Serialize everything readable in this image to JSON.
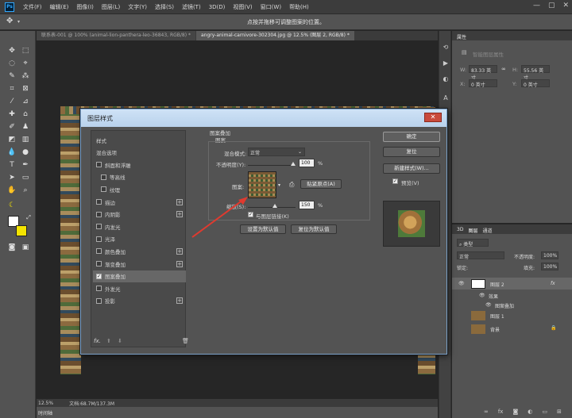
{
  "menubar": {
    "app_icon": "Ps",
    "items": [
      "文件(F)",
      "编辑(E)",
      "图像(I)",
      "图层(L)",
      "文字(Y)",
      "选择(S)",
      "滤镜(T)",
      "3D(D)",
      "视图(V)",
      "窗口(W)",
      "帮助(H)"
    ]
  },
  "optionsbar": {
    "hint": "点按并拖移可调整图案的位置。"
  },
  "tabs": [
    {
      "label": "联系表-001 @ 100% (animal-lion-panthera-leo-36843, RGB/8) *",
      "active": false
    },
    {
      "label": "angry-animal-carnivore-302304.jpg @ 12.5% (图层 2, RGB/8) *",
      "active": true
    }
  ],
  "status": {
    "zoom": "12.5%",
    "doc": "文档:68.7M/137.3M",
    "timeline": "时间轴"
  },
  "properties": {
    "tab": "属性",
    "title": "智能图层属性",
    "w_label": "W:",
    "w_value": "83.33 英寸",
    "h_label": "H:",
    "h_value": "55.56 英寸",
    "x_label": "X:",
    "x_value": "0 英寸",
    "y_label": "Y:",
    "y_value": "0 英寸"
  },
  "layers": {
    "tabs": [
      "3D",
      "图层",
      "通道"
    ],
    "filter": "类型",
    "blend": "正常",
    "opacity_label": "不透明度:",
    "opacity": "100%",
    "lock_label": "锁定:",
    "fill_label": "填充:",
    "fill": "100%",
    "rows": [
      {
        "name": "图层 2",
        "fx": "fx"
      },
      {
        "name": "效果"
      },
      {
        "name": "图案叠加"
      },
      {
        "name": "图层 1"
      },
      {
        "name": "背景"
      }
    ]
  },
  "dialog": {
    "title": "图层样式",
    "close": "✕",
    "styles": [
      {
        "label": "样式",
        "cb": false,
        "plus": false,
        "header": true
      },
      {
        "label": "混合选项",
        "cb": false,
        "plus": false,
        "header": true
      },
      {
        "label": "斜面和浮雕",
        "cb": true,
        "plus": false
      },
      {
        "label": "等高线",
        "cb": true,
        "plus": false,
        "indent": true
      },
      {
        "label": "纹理",
        "cb": true,
        "plus": false,
        "indent": true
      },
      {
        "label": "描边",
        "cb": true,
        "plus": true
      },
      {
        "label": "内阴影",
        "cb": true,
        "plus": true
      },
      {
        "label": "内发光",
        "cb": true,
        "plus": false
      },
      {
        "label": "光泽",
        "cb": true,
        "plus": false
      },
      {
        "label": "颜色叠加",
        "cb": true,
        "plus": true
      },
      {
        "label": "渐变叠加",
        "cb": true,
        "plus": true
      },
      {
        "label": "图案叠加",
        "cb": true,
        "plus": false,
        "checked": true,
        "selected": true
      },
      {
        "label": "外发光",
        "cb": true,
        "plus": false
      },
      {
        "label": "投影",
        "cb": true,
        "plus": true
      }
    ],
    "fx": "fx.",
    "section": "图案叠加",
    "group": "图案",
    "blend_label": "混合模式:",
    "blend_value": "正常",
    "opacity_label": "不透明度(Y):",
    "opacity_value": "100",
    "pct": "%",
    "pattern_label": "图案:",
    "snap_btn": "贴紧原点(A)",
    "scale_label": "缩放(S):",
    "scale_value": "150",
    "link_label": "与图层链接(K)",
    "make_default": "设置为默认值",
    "reset_default": "复位为默认值",
    "ok": "确定",
    "reset": "复位",
    "new_style": "新建样式(W)...",
    "preview": "预览(V)"
  },
  "colors": {
    "accent": "#e03a2f",
    "primary_fg": "#ffffff",
    "primary_bg": "#f4e400"
  }
}
